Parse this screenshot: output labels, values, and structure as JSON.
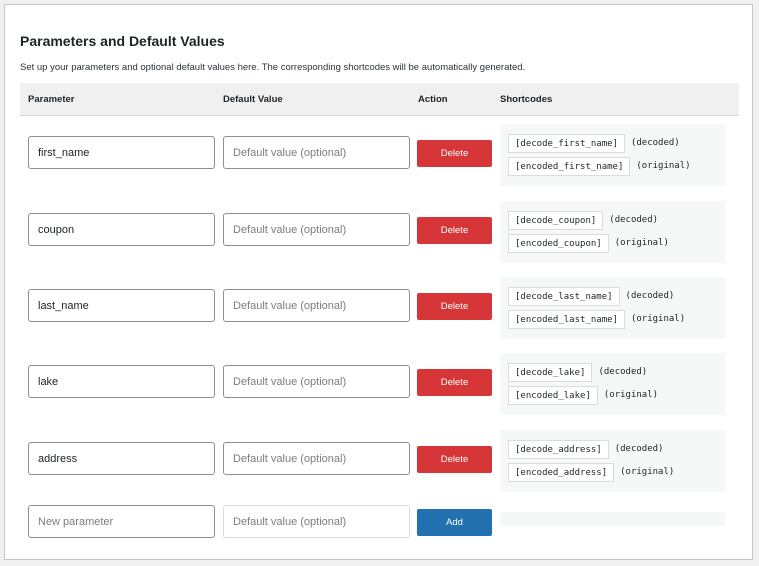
{
  "section": {
    "title": "Parameters and Default Values",
    "description": "Set up your parameters and optional default values here. The corresponding shortcodes will be automatically generated."
  },
  "table": {
    "headers": {
      "parameter": "Parameter",
      "default_value": "Default Value",
      "action": "Action",
      "shortcodes": "Shortcodes"
    },
    "rows": [
      {
        "parameter": "first_name",
        "default_placeholder": "Default value (optional)",
        "action_label": "Delete",
        "shortcode_decode": "[decode_first_name]",
        "decode_note": "(decoded)",
        "shortcode_encode": "[encoded_first_name]",
        "encode_note": "(original)"
      },
      {
        "parameter": "coupon",
        "default_placeholder": "Default value (optional)",
        "action_label": "Delete",
        "shortcode_decode": "[decode_coupon]",
        "decode_note": "(decoded)",
        "shortcode_encode": "[encoded_coupon]",
        "encode_note": "(original)"
      },
      {
        "parameter": "last_name",
        "default_placeholder": "Default value (optional)",
        "action_label": "Delete",
        "shortcode_decode": "[decode_last_name]",
        "decode_note": "(decoded)",
        "shortcode_encode": "[encoded_last_name]",
        "encode_note": "(original)"
      },
      {
        "parameter": "lake",
        "default_placeholder": "Default value (optional)",
        "action_label": "Delete",
        "shortcode_decode": "[decode_lake]",
        "decode_note": "(decoded)",
        "shortcode_encode": "[encoded_lake]",
        "encode_note": "(original)"
      },
      {
        "parameter": "address",
        "default_placeholder": "Default value (optional)",
        "action_label": "Delete",
        "shortcode_decode": "[decode_address]",
        "decode_note": "(decoded)",
        "shortcode_encode": "[encoded_address]",
        "encode_note": "(original)"
      }
    ],
    "new_row": {
      "parameter_placeholder": "New parameter",
      "default_placeholder": "Default value (optional)",
      "action_label": "Add"
    }
  },
  "colors": {
    "delete": "#d63638",
    "add": "#2271b1",
    "header_bg": "#f0f0f1"
  }
}
